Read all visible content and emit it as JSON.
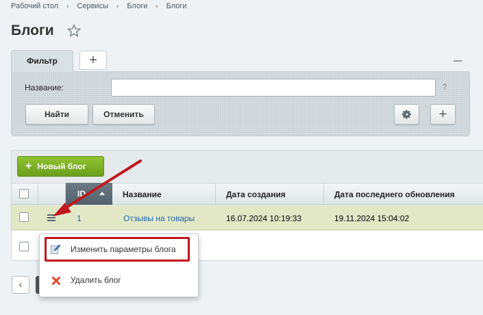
{
  "breadcrumb": [
    "Рабочий стол",
    "Сервисы",
    "Блоги",
    "Блоги"
  ],
  "page": {
    "title": "Блоги"
  },
  "filter": {
    "tab_label": "Фильтр",
    "add_tab": "+",
    "name_label": "Название:",
    "name_value": "",
    "help": "?",
    "find_label": "Найти",
    "cancel_label": "Отменить",
    "add_label": "+"
  },
  "toolbar": {
    "new_blog_label": "Новый блог"
  },
  "table": {
    "columns": [
      "ID",
      "Название",
      "Дата создания",
      "Дата последнего обновления"
    ],
    "rows": [
      {
        "id": "1",
        "name": "Отзывы на товары",
        "created": "16.07.2024 10:19:33",
        "updated": "19.11.2024 15:04:02"
      }
    ]
  },
  "context_menu": {
    "items": [
      {
        "label": "Изменить параметры блога",
        "icon": "edit-icon"
      },
      {
        "label": "Удалить блог",
        "icon": "delete-icon"
      }
    ]
  },
  "pager": {
    "prev": "‹"
  },
  "colors": {
    "accent_green": "#7cb12a",
    "highlight_red": "#c0161d",
    "link_blue": "#2067b0",
    "row_selected": "#e2e8c6"
  }
}
